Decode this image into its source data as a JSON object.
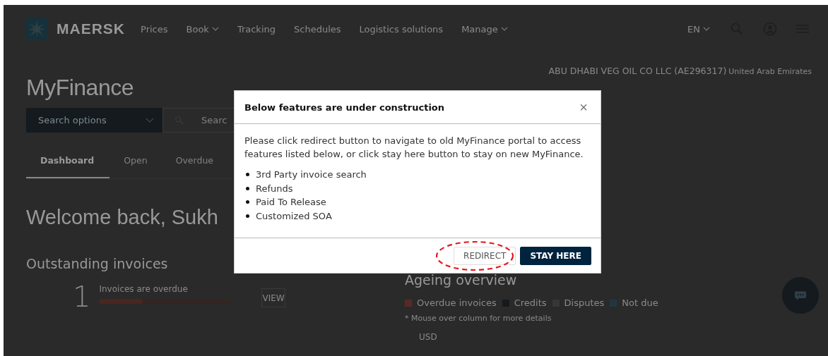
{
  "header": {
    "brand": "MAERSK",
    "nav": [
      {
        "label": "Prices",
        "dropdown": false
      },
      {
        "label": "Book",
        "dropdown": true
      },
      {
        "label": "Tracking",
        "dropdown": false
      },
      {
        "label": "Schedules",
        "dropdown": false
      },
      {
        "label": "Logistics solutions",
        "dropdown": false
      },
      {
        "label": "Manage",
        "dropdown": true
      }
    ],
    "language": "EN"
  },
  "account": {
    "company": "ABU DHABI VEG OIL CO LLC (AE296317)",
    "country": "United Arab Emirates"
  },
  "page_title": "MyFinance",
  "search": {
    "select": "Search options",
    "placeholder": "Searc"
  },
  "tabs": [
    {
      "label": "Dashboard",
      "selected": true
    },
    {
      "label": "Open",
      "selected": false
    },
    {
      "label": "Overdue",
      "selected": false
    }
  ],
  "welcome": "Welcome back, Sukh",
  "outstanding": {
    "title": "Outstanding invoices",
    "count": "1",
    "label": "Invoices are overdue",
    "level": 0.33,
    "button": "VIEW"
  },
  "ageing": {
    "title": "Ageing overview",
    "legend": [
      {
        "label": "Overdue invoices",
        "color": "#5a2a22"
      },
      {
        "label": "Credits",
        "color": "#141a1e"
      },
      {
        "label": "Disputes",
        "color": "#363636"
      },
      {
        "label": "Not due",
        "color": "#213740"
      }
    ],
    "note": "* Mouse over column for more details",
    "currency": "USD"
  },
  "dialog": {
    "title": "Below features are under construction",
    "close": "×",
    "message": "Please click redirect button to navigate to old MyFinance portal to access features listed below, or click stay here button to stay on new MyFinance.",
    "items": [
      "3rd Party invoice search",
      "Refunds",
      "Paid To Release",
      "Customized SOA"
    ],
    "buttons": [
      {
        "label": "REDIRECT",
        "kind": "secondary",
        "highlighted": true
      },
      {
        "label": "STAY HERE",
        "kind": "primary",
        "highlighted": false
      }
    ]
  }
}
